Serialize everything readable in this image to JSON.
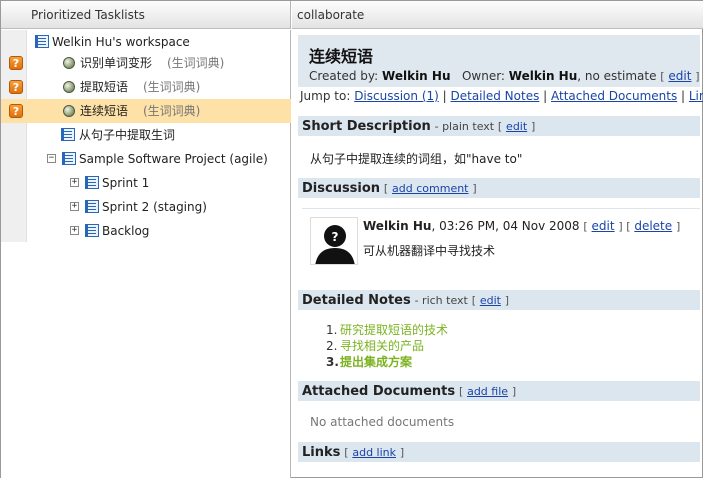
{
  "header": {
    "left_title": "Prioritized Tasklists",
    "right_title": "collaborate"
  },
  "tree": {
    "workspace": "Welkin Hu's workspace",
    "items": [
      {
        "label": "识别单词变形",
        "tag": "(生词词典)",
        "flag": "?"
      },
      {
        "label": "提取短语",
        "tag": "(生词词典)",
        "flag": "?"
      },
      {
        "label": "连续短语",
        "tag": "(生词词典)",
        "flag": "?"
      }
    ],
    "list_item": "从句子中提取生词",
    "project": "Sample Software Project (agile)",
    "sprints": [
      "Sprint 1",
      "Sprint 2 (staging)",
      "Backlog"
    ]
  },
  "task": {
    "title": "连续短语",
    "created_label": "Created by:",
    "created_by": "Welkin Hu",
    "owner_label": "Owner:",
    "owner": "Welkin Hu",
    "estimate": ", no estimate",
    "edit": "edit"
  },
  "jump": {
    "label": "Jump to:",
    "links": [
      "Discussion (1)",
      "Detailed Notes",
      "Attached Documents",
      "Links"
    ]
  },
  "short_description": {
    "title": "Short Description",
    "meta": "- plain text",
    "edit": "edit",
    "text": "从句子中提取连续的词组，如\"have to\""
  },
  "discussion": {
    "title": "Discussion",
    "add": "add comment",
    "comment": {
      "author": "Welkin Hu",
      "time": ", 03:26 PM, 04 Nov 2008",
      "edit": "edit",
      "delete": "delete",
      "text": "可从机器翻译中寻找技术"
    }
  },
  "detailed_notes": {
    "title": "Detailed Notes",
    "meta": "- rich text",
    "edit": "edit",
    "items": [
      "研究提取短语的技术",
      "寻找相关的产品",
      "提出集成方案"
    ],
    "numbers": [
      "1.",
      "2.",
      "3."
    ]
  },
  "attached": {
    "title": "Attached Documents",
    "add": "add file",
    "empty": "No attached documents"
  },
  "links": {
    "title": "Links",
    "add": "add link"
  },
  "colors": {
    "section_bg": "#dce6ef",
    "selected_row": "#fde1a6",
    "link": "#1a44a8",
    "note_green": "#7ab320",
    "flag_orange": "#e06f0c"
  }
}
